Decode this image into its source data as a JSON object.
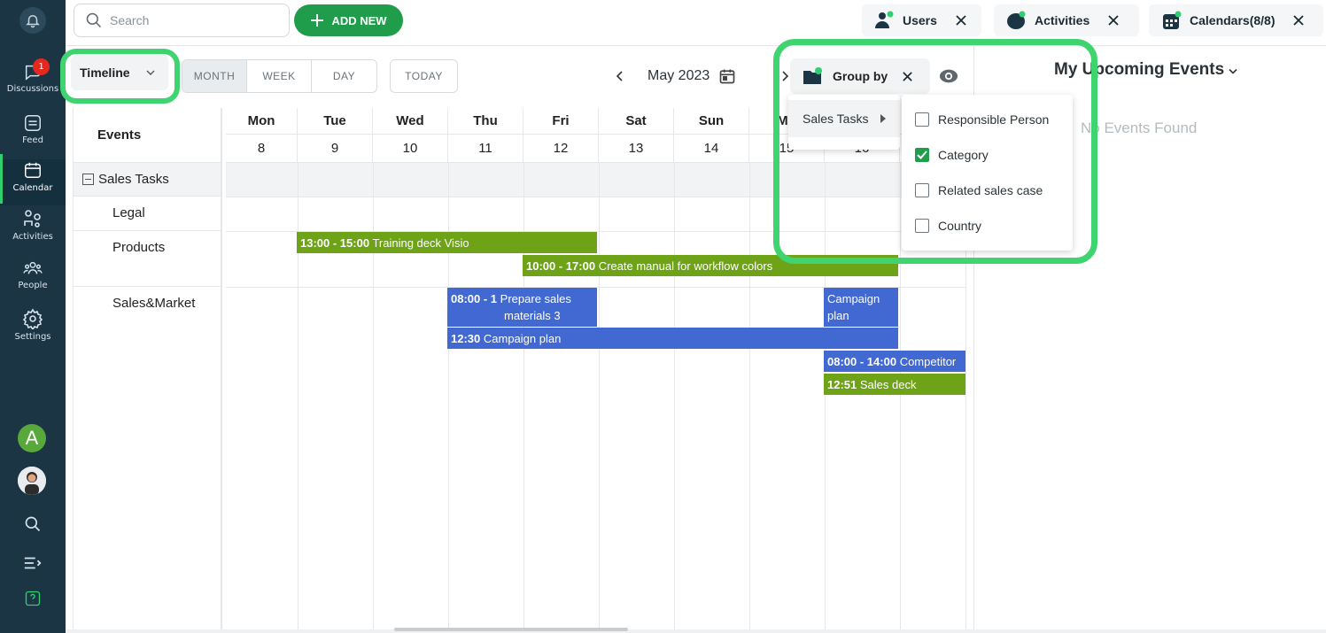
{
  "sidebar": {
    "discussions": {
      "label": "Discussions",
      "badge": "1"
    },
    "feed": {
      "label": "Feed"
    },
    "calendar": {
      "label": "Calendar"
    },
    "activities": {
      "label": "Activities"
    },
    "people": {
      "label": "People"
    },
    "settings": {
      "label": "Settings"
    },
    "avatar_letter": "A"
  },
  "topbar": {
    "search_placeholder": "Search",
    "add_new": "ADD NEW",
    "filters": [
      {
        "label": "Users"
      },
      {
        "label": "Activities"
      },
      {
        "label": "Calendars(8/8)"
      }
    ]
  },
  "toolbar": {
    "view_select": "Timeline",
    "ranges": [
      "MONTH",
      "WEEK",
      "DAY"
    ],
    "selected_range": "MONTH",
    "today": "TODAY",
    "current_period": "May 2023",
    "group_by": "Group by"
  },
  "grid": {
    "events_header": "Events",
    "group": "Sales Tasks",
    "rows": [
      "Legal",
      "Products",
      "Sales&Market"
    ],
    "days": [
      {
        "name": "Mon",
        "date": "8"
      },
      {
        "name": "Tue",
        "date": "9"
      },
      {
        "name": "Wed",
        "date": "10"
      },
      {
        "name": "Thu",
        "date": "11"
      },
      {
        "name": "Fri",
        "date": "12"
      },
      {
        "name": "Sat",
        "date": "13"
      },
      {
        "name": "Sun",
        "date": "14"
      },
      {
        "name": "Mo",
        "date": "15"
      },
      {
        "name": "",
        "date": "16"
      },
      {
        "name": "",
        "date": ""
      }
    ]
  },
  "events": [
    {
      "time": "13:00 - 15:00",
      "title": "Training deck Visio",
      "color": "#6ea318"
    },
    {
      "time": "10:00 - 17:00",
      "title": "Create manual for workflow colors",
      "color": "#6ea318"
    },
    {
      "time": "08:00 - 1",
      "title": "Prepare sales",
      "title2": "materials 3",
      "color": "#4169d1"
    },
    {
      "time": "",
      "title": "Campaign",
      "title2": "plan",
      "color": "#4169d1"
    },
    {
      "time": "12:30",
      "title": "Campaign plan",
      "color": "#4169d1"
    },
    {
      "time": "08:00 - 14:00",
      "title": "Competitor",
      "color": "#4169d1"
    },
    {
      "time": "12:51",
      "title": "Sales deck",
      "color": "#6ea318"
    }
  ],
  "group_menu": {
    "item": "Sales Tasks",
    "options": [
      {
        "label": "Responsible Person",
        "checked": false
      },
      {
        "label": "Category",
        "checked": true
      },
      {
        "label": "Related sales case",
        "checked": false
      },
      {
        "label": "Country",
        "checked": false
      }
    ]
  },
  "right_panel": {
    "title": "My Upcoming Events",
    "empty": "No Events Found"
  },
  "colors": {
    "accent": "#1f9d4a",
    "highlight": "#3fd46f",
    "sidebar": "#1b3545"
  }
}
